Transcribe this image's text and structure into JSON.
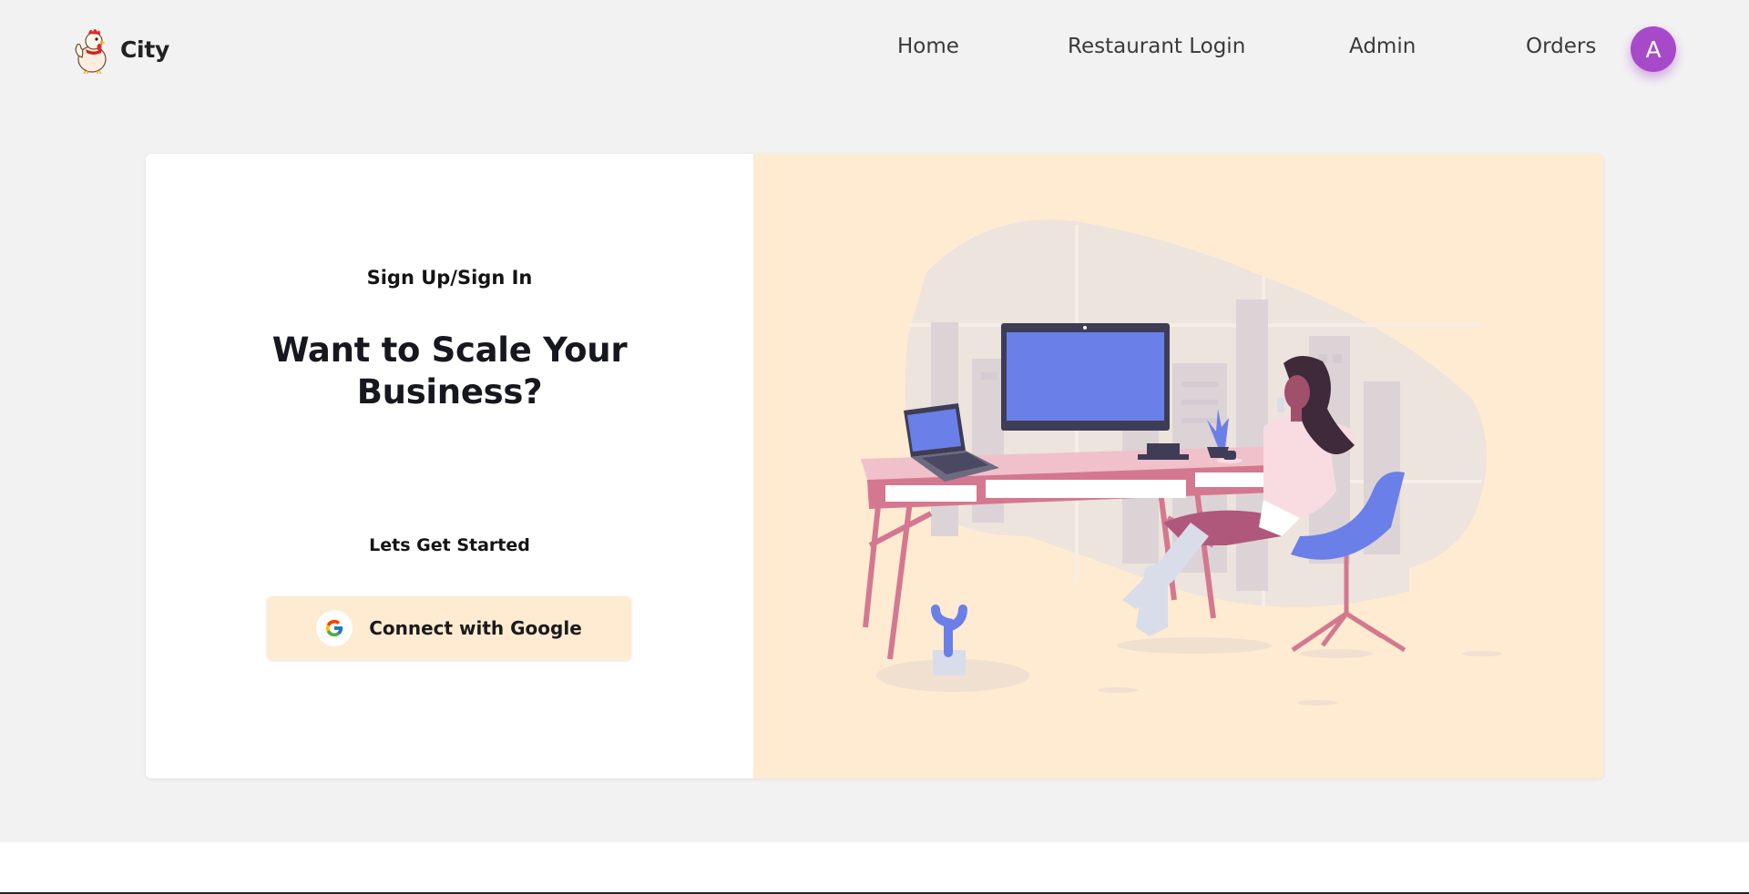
{
  "brand": {
    "name": "City",
    "logo_icon": "rooster-mascot-icon"
  },
  "nav": {
    "home": "Home",
    "restaurant_login": "Restaurant Login",
    "admin": "Admin",
    "orders": "Orders"
  },
  "user": {
    "avatar_initial": "A",
    "avatar_color": "#a64ac9"
  },
  "card": {
    "eyebrow": "Sign Up/Sign In",
    "headline_line1": "Want to Scale Your",
    "headline_line2": "Business?",
    "subhead": "Lets Get Started",
    "google_button_label": "Connect with Google",
    "google_icon": "google-g-icon",
    "illustration": "woman-at-desk-illustration"
  },
  "colors": {
    "page_bg": "#f3f2f3",
    "accent_panel": "#feebd2",
    "monitor_screen": "#6b7fe8"
  }
}
